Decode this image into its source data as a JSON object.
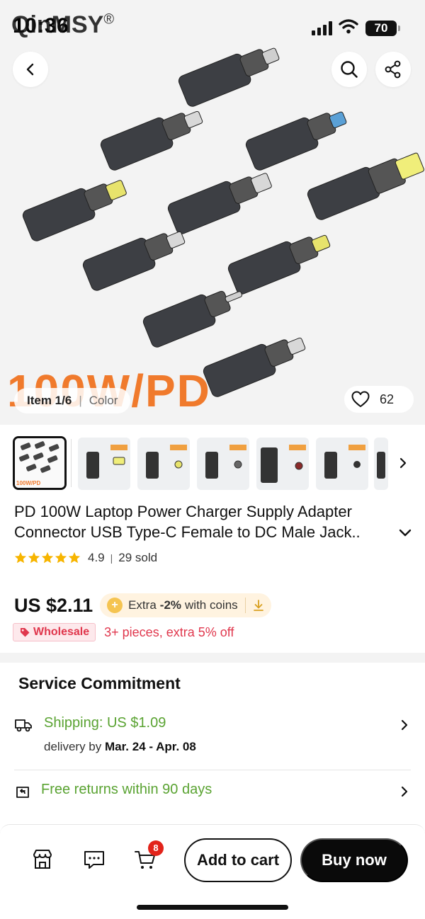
{
  "status_bar": {
    "brand": "QinMSY",
    "brand_mark": "®",
    "time": "10:36",
    "battery": "70"
  },
  "hero": {
    "banner_text": "100W/PD",
    "item_counter": "Item 1/6",
    "variant_label": "Color",
    "favorites_count": "62"
  },
  "thumbnails": {
    "count": 7,
    "active_index": 0,
    "first_thumb_caption": "100W/PD"
  },
  "product": {
    "title_line1": "PD 100W Laptop Power Charger Supply Adapter",
    "title_line2": "Connector USB Type-C Female to DC Male Jack..",
    "rating": "4.9",
    "sold": "29 sold",
    "star_count": 5,
    "price": "US $2.11",
    "coins_prefix": "Extra",
    "coins_pct": "-2%",
    "coins_suffix": "with coins",
    "wholesale_tag": "Wholesale",
    "wholesale_text": "3+ pieces, extra 5% off"
  },
  "service": {
    "heading": "Service Commitment",
    "shipping_label": "Shipping: US $1.09",
    "delivery_prefix": "delivery by",
    "delivery_dates": "Mar. 24 - Apr. 08",
    "returns_label": "Free returns within 90 days"
  },
  "bottom_bar": {
    "cart_badge": "8",
    "add_to_cart": "Add to cart",
    "buy_now": "Buy now"
  },
  "colors": {
    "accent_green": "#5aa332",
    "wholesale_red": "#e0374d",
    "banner_orange": "#f07a2c",
    "badge_red": "#e2231a"
  }
}
